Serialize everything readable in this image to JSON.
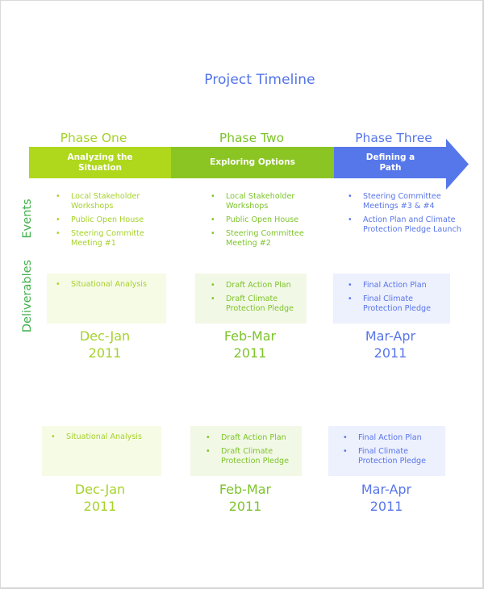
{
  "title": "Project Timeline",
  "colors": {
    "phase_one": "#afd81c",
    "phase_two": "#8bc524",
    "phase_three": "#5677ea",
    "row_label": "#3fb04a",
    "title": "#5273e8"
  },
  "row_labels": {
    "events": "Events",
    "deliverables": "Deliverables"
  },
  "phases": [
    {
      "heading": "Phase One",
      "bar_label_line1": "Analyzing the",
      "bar_label_line2": "Situation",
      "events": [
        "Local Stakeholder Workshops",
        "Public Open House",
        "Steering Committe Meeting #1"
      ],
      "deliverables": [
        "Situational Analysis"
      ],
      "period": "Dec-Jan",
      "year": "2011"
    },
    {
      "heading": "Phase Two",
      "bar_label_line1": "Exploring Options",
      "bar_label_line2": "",
      "events": [
        "Local Stakeholder Workshops",
        "Public Open House",
        "Steering Committee Meeting #2"
      ],
      "deliverables": [
        "Draft Action Plan",
        "Draft Climate Protection Pledge"
      ],
      "period": "Feb-Mar",
      "year": "2011"
    },
    {
      "heading": "Phase Three",
      "bar_label_line1": "Defining a",
      "bar_label_line2": "Path",
      "events": [
        "Steering Committee Meetings #3 & #4",
        "Action Plan and Climate Protection Pledge Launch"
      ],
      "deliverables": [
        "Final Action Plan",
        "Final Climate Protection Pledge"
      ],
      "period": "Mar-Apr",
      "year": "2011"
    }
  ],
  "bullet": "•"
}
